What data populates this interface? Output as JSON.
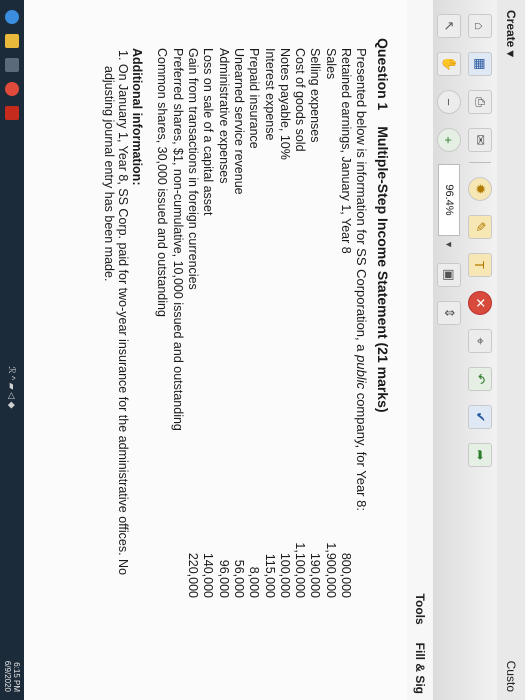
{
  "menu": {
    "create_label": "Create ▾",
    "custom_label": "Custo"
  },
  "toolbar": {
    "zoom_value": "96.4%",
    "zoom_dropdown_glyph": "▼"
  },
  "panel": {
    "tools_label": "Tools",
    "fill_sign_label": "Fill & Sig"
  },
  "question": {
    "number": "Question 1",
    "title": "Multiple-Step Income Statement (21 marks)",
    "intro_prefix": "Presented below is information for SS Corporation, a ",
    "intro_emphasis": "public",
    "intro_suffix": " company, for Year 8:",
    "items": [
      {
        "label": "Retained earnings, January 1, Year 8",
        "value": "800,000"
      },
      {
        "label": "Sales",
        "value": "1,900,000"
      },
      {
        "label": "Selling expenses",
        "value": "190,000"
      },
      {
        "label": "Cost of goods sold",
        "value": "1,100,000"
      },
      {
        "label": "Notes payable, 10%",
        "value": "100,000"
      },
      {
        "label": "Interest expense",
        "value": "115,000"
      },
      {
        "label": "Prepaid insurance",
        "value": "8,000"
      },
      {
        "label": "Unearned service revenue",
        "value": "56,000"
      },
      {
        "label": "Administrative expenses",
        "value": "96,000"
      },
      {
        "label": "Loss on sale of a capital asset",
        "value": "140,000"
      },
      {
        "label": "Gain from transactions in foreign currencies",
        "value": "220,000"
      },
      {
        "label": "Preferred shares, $1, non-cumulative, 10,000 issued and outstanding",
        "value": ""
      },
      {
        "label": "Common shares, 30,000 issued and outstanding",
        "value": ""
      }
    ],
    "additional_title": "Additional information:",
    "additional_items": [
      {
        "line1": "1.  On January 1, Year 8, SS Corp. paid for two-year insurance for the administrative offices. No",
        "line2": "adjusting journal entry has been made."
      }
    ]
  },
  "taskbar": {
    "clock_time": "6:15 PM",
    "clock_date": "6/9/2020",
    "tray_text": "ℛ ^ ▰ ◁ ◆"
  }
}
